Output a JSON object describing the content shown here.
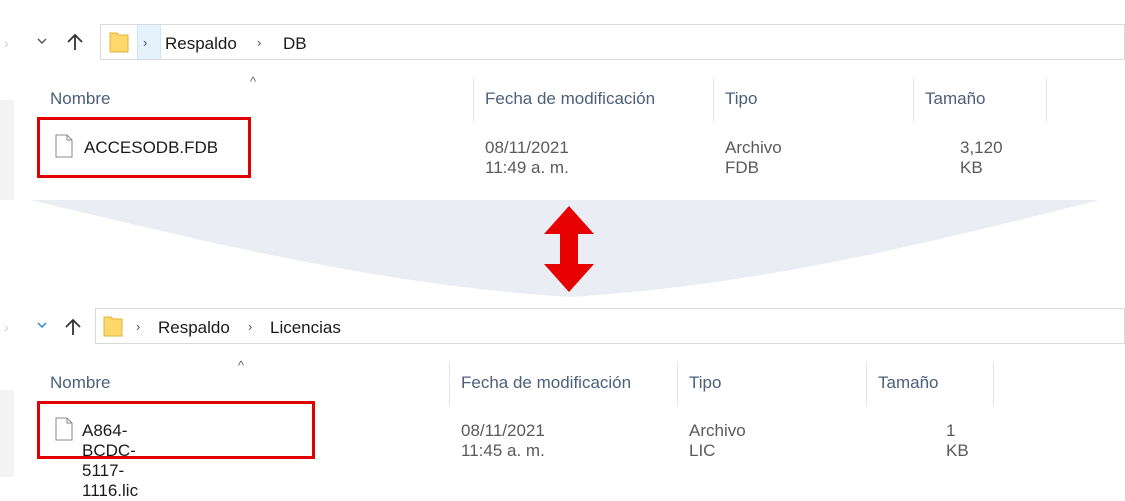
{
  "windows": [
    {
      "breadcrumb": [
        "Respaldo",
        "DB"
      ],
      "columns": {
        "name": "Nombre",
        "date": "Fecha de modificación",
        "type": "Tipo",
        "size": "Tamaño"
      },
      "file": {
        "name": "ACCESODB.FDB",
        "date": "08/11/2021 11:49 a. m.",
        "type": "Archivo FDB",
        "size": "3,120 KB"
      }
    },
    {
      "breadcrumb": [
        "Respaldo",
        "Licencias"
      ],
      "columns": {
        "name": "Nombre",
        "date": "Fecha de modificación",
        "type": "Tipo",
        "size": "Tamaño"
      },
      "file": {
        "name": "A864-BCDC-5117-1116.lic",
        "date": "08/11/2021 11:45 a. m.",
        "type": "Archivo LIC",
        "size": "1 KB"
      }
    }
  ],
  "icons": [
    "chevron-right-icon",
    "chevron-down-icon",
    "up-arrow-icon",
    "folder-icon",
    "file-icon",
    "double-arrow-icon"
  ],
  "colors": {
    "highlight_box": "#e00000",
    "double_arrow": "#e60000",
    "column_header": "#4c607a",
    "address_highlight": "#e5f1fb",
    "wedge": "#eaeef4"
  }
}
